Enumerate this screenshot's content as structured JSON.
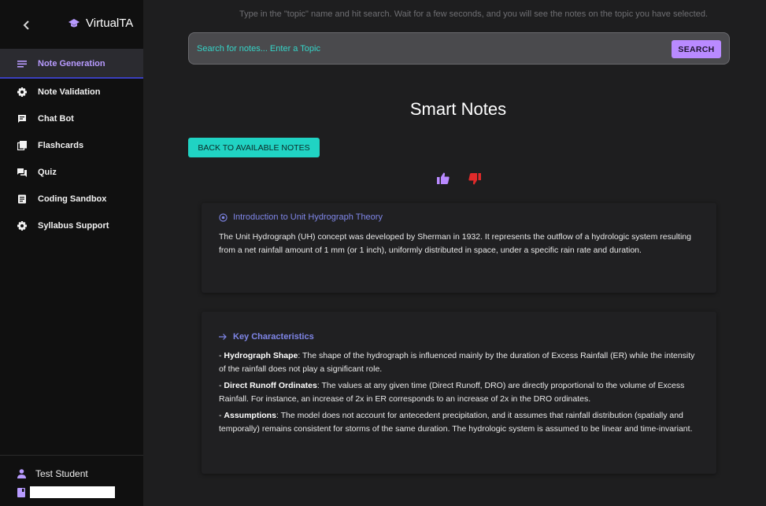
{
  "sidebar": {
    "brand": "VirtualTA",
    "items": [
      {
        "label": "Note Generation",
        "icon": "menu-lines-icon"
      },
      {
        "label": "Note Validation",
        "icon": "gear-icon"
      },
      {
        "label": "Chat Bot",
        "icon": "chat-icon"
      },
      {
        "label": "Flashcards",
        "icon": "cards-icon"
      },
      {
        "label": "Quiz",
        "icon": "forum-icon"
      },
      {
        "label": "Coding Sandbox",
        "icon": "document-icon"
      },
      {
        "label": "Syllabus Support",
        "icon": "gear-icon"
      }
    ],
    "user": "Test Student"
  },
  "main": {
    "hint": "Type in the \"topic\" name and hit search. Wait for a few seconds, and you will see the notes on the topic you have selected.",
    "search_placeholder": "Search for notes... Enter a Topic",
    "search_button": "SEARCH",
    "title": "Smart Notes",
    "back_button": "BACK TO AVAILABLE NOTES",
    "cards": [
      {
        "heading": "Introduction to Unit Hydrograph Theory",
        "body": "The Unit Hydrograph (UH) concept was developed by Sherman in 1932. It represents the outflow of a hydrologic system resulting from a net rainfall amount of 1 mm (or 1 inch), uniformly distributed in space, under a specific rain rate and duration."
      },
      {
        "heading": "Key Characteristics",
        "points": [
          {
            "term": "Hydrograph Shape",
            "text": ": The shape of the hydrograph is influenced mainly by the duration of Excess Rainfall (ER) while the intensity of the rainfall does not play a significant role."
          },
          {
            "term": "Direct Runoff Ordinates",
            "text": ": The values at any given time (Direct Runoff, DRO) are directly proportional to the volume of Excess Rainfall. For instance, an increase of 2x in ER corresponds to an increase of 2x in the DRO ordinates."
          },
          {
            "term": "Assumptions",
            "text": ": The model does not account for antecedent precipitation, and it assumes that rainfall distribution (spatially and temporally) remains consistent for storms of the same duration. The hydrologic system is assumed to be linear and time-invariant."
          }
        ]
      }
    ]
  },
  "colors": {
    "accent_purple": "#b98aff",
    "accent_teal": "#20d3c3",
    "heading_blue": "#7f86e8",
    "thumb_up": "#b98aff",
    "thumb_down": "#e02a2a"
  }
}
